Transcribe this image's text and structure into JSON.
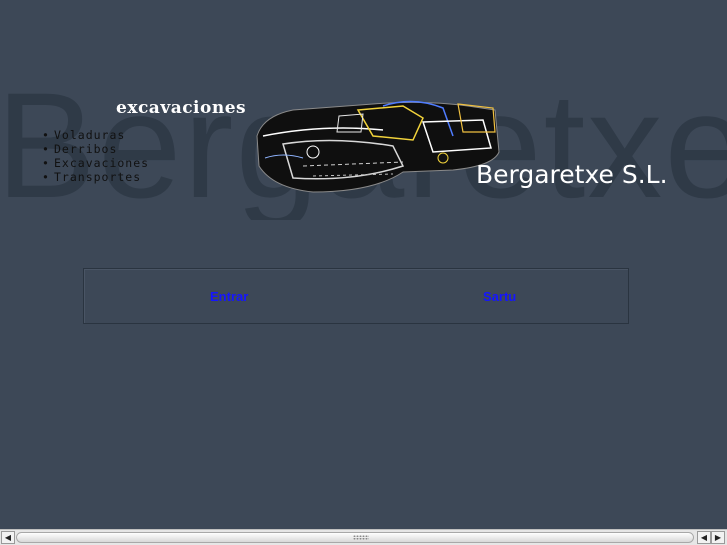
{
  "header": {
    "watermark": "Bergaretxe",
    "subtitle": "excavaciones",
    "brand": "Bergaretxe S.L."
  },
  "services": [
    {
      "bullet": "•",
      "label": "Voladuras"
    },
    {
      "bullet": "•",
      "label": "Derribos"
    },
    {
      "bullet": "•",
      "label": "Excavaciones"
    },
    {
      "bullet": "•",
      "label": "Transportes"
    }
  ],
  "nav": {
    "enter_label": "Entrar",
    "sartu_label": "Sartu"
  },
  "scrollbar": {
    "left_arrow": "◀",
    "right_arrow": "▶"
  },
  "colors": {
    "background": "#3d4857",
    "link": "#1515ff",
    "watermark": "#2f3a47"
  }
}
